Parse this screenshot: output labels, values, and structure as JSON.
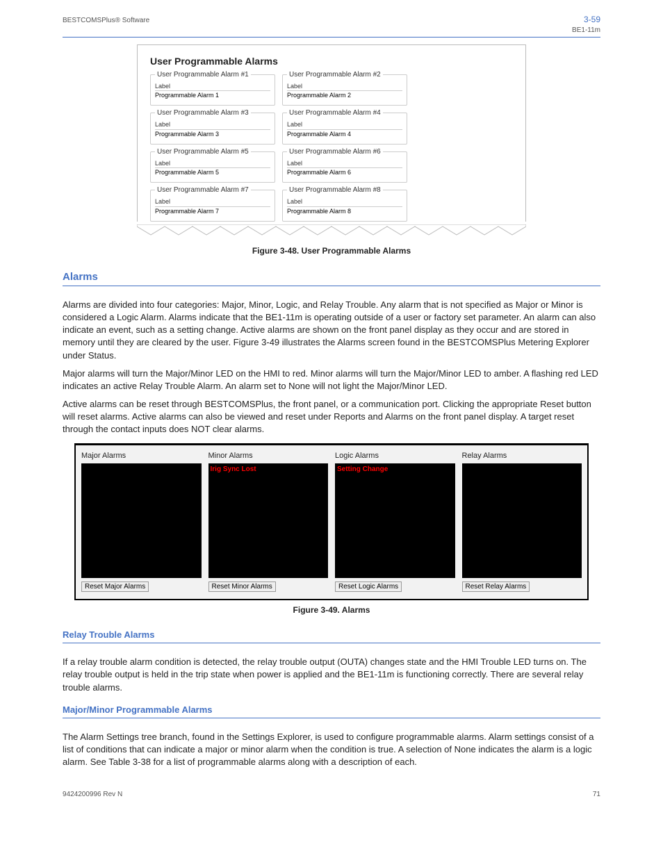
{
  "header": {
    "left": "BESTCOMSPlus® Software",
    "right_num": "3-59",
    "right_txt": "BE1-11m"
  },
  "upa": {
    "title": "User Programmable Alarms",
    "alarms": [
      {
        "legend": "User Programmable Alarm #1",
        "label": "Label",
        "value": "Programmable Alarm 1"
      },
      {
        "legend": "User Programmable Alarm #2",
        "label": "Label",
        "value": "Programmable Alarm 2"
      },
      {
        "legend": "User Programmable Alarm #3",
        "label": "Label",
        "value": "Programmable Alarm 3"
      },
      {
        "legend": "User Programmable Alarm #4",
        "label": "Label",
        "value": "Programmable Alarm 4"
      },
      {
        "legend": "User Programmable Alarm #5",
        "label": "Label",
        "value": "Programmable Alarm 5"
      },
      {
        "legend": "User Programmable Alarm #6",
        "label": "Label",
        "value": "Programmable Alarm 6"
      },
      {
        "legend": "User Programmable Alarm #7",
        "label": "Label",
        "value": "Programmable Alarm 7"
      },
      {
        "legend": "User Programmable Alarm #8",
        "label": "Label",
        "value": "Programmable Alarm 8"
      }
    ],
    "caption": "Figure 3-48. User Programmable Alarms"
  },
  "alarms_section": {
    "title": "Alarms",
    "p1": "Alarms are divided into four categories: Major, Minor, Logic, and Relay Trouble. Any alarm that is not specified as Major or Minor is considered a Logic Alarm. Alarms indicate that the BE1-11m is operating outside of a user or factory set parameter. An alarm can also indicate an event, such as a setting change. Active alarms are shown on the front panel display as they occur and are stored in memory until they are cleared by the user. Figure 3-49 illustrates the Alarms screen found in the BESTCOMSPlus Metering Explorer under Status.",
    "p2": "Major alarms will turn the Major/Minor LED on the HMI to red. Minor alarms will turn the Major/Minor LED to amber. A flashing red LED indicates an active Relay Trouble Alarm. An alarm set to None will not light the Major/Minor LED.",
    "p3": "Active alarms can be reset through BESTCOMSPlus, the front panel, or a communication port. Clicking the appropriate Reset button will reset alarms. Active alarms can also be viewed and reset under Reports and Alarms on the front panel display. A target reset through the contact inputs does NOT clear alarms."
  },
  "status": {
    "cols": [
      {
        "title": "Major Alarms",
        "items": [],
        "btn": "Reset Major Alarms"
      },
      {
        "title": "Minor Alarms",
        "items": [
          "Irig Sync Lost"
        ],
        "btn": "Reset Minor Alarms"
      },
      {
        "title": "Logic Alarms",
        "items": [
          "Setting Change"
        ],
        "btn": "Reset Logic Alarms"
      },
      {
        "title": "Relay Alarms",
        "items": [],
        "btn": "Reset Relay Alarms"
      }
    ],
    "caption": "Figure 3-49. Alarms"
  },
  "relay_trouble": {
    "title": "Relay Trouble Alarms",
    "p1": "If a relay trouble alarm condition is detected, the relay trouble output (OUTA) changes state and the HMI Trouble LED turns on. The relay trouble output is held in the trip state when power is applied and the BE1-11m is functioning correctly. There are several relay trouble alarms."
  },
  "major_minor": {
    "title": "Major/Minor Programmable Alarms",
    "p1": "The Alarm Settings tree branch, found in the Settings Explorer, is used to configure programmable alarms. Alarm settings consist of a list of conditions that can indicate a major or minor alarm when the condition is true. A selection of None indicates the alarm is a logic alarm. See Table 3-38 for a list of programmable alarms along with a description of each."
  },
  "footer": {
    "left": "9424200996 Rev N",
    "right": "71"
  }
}
